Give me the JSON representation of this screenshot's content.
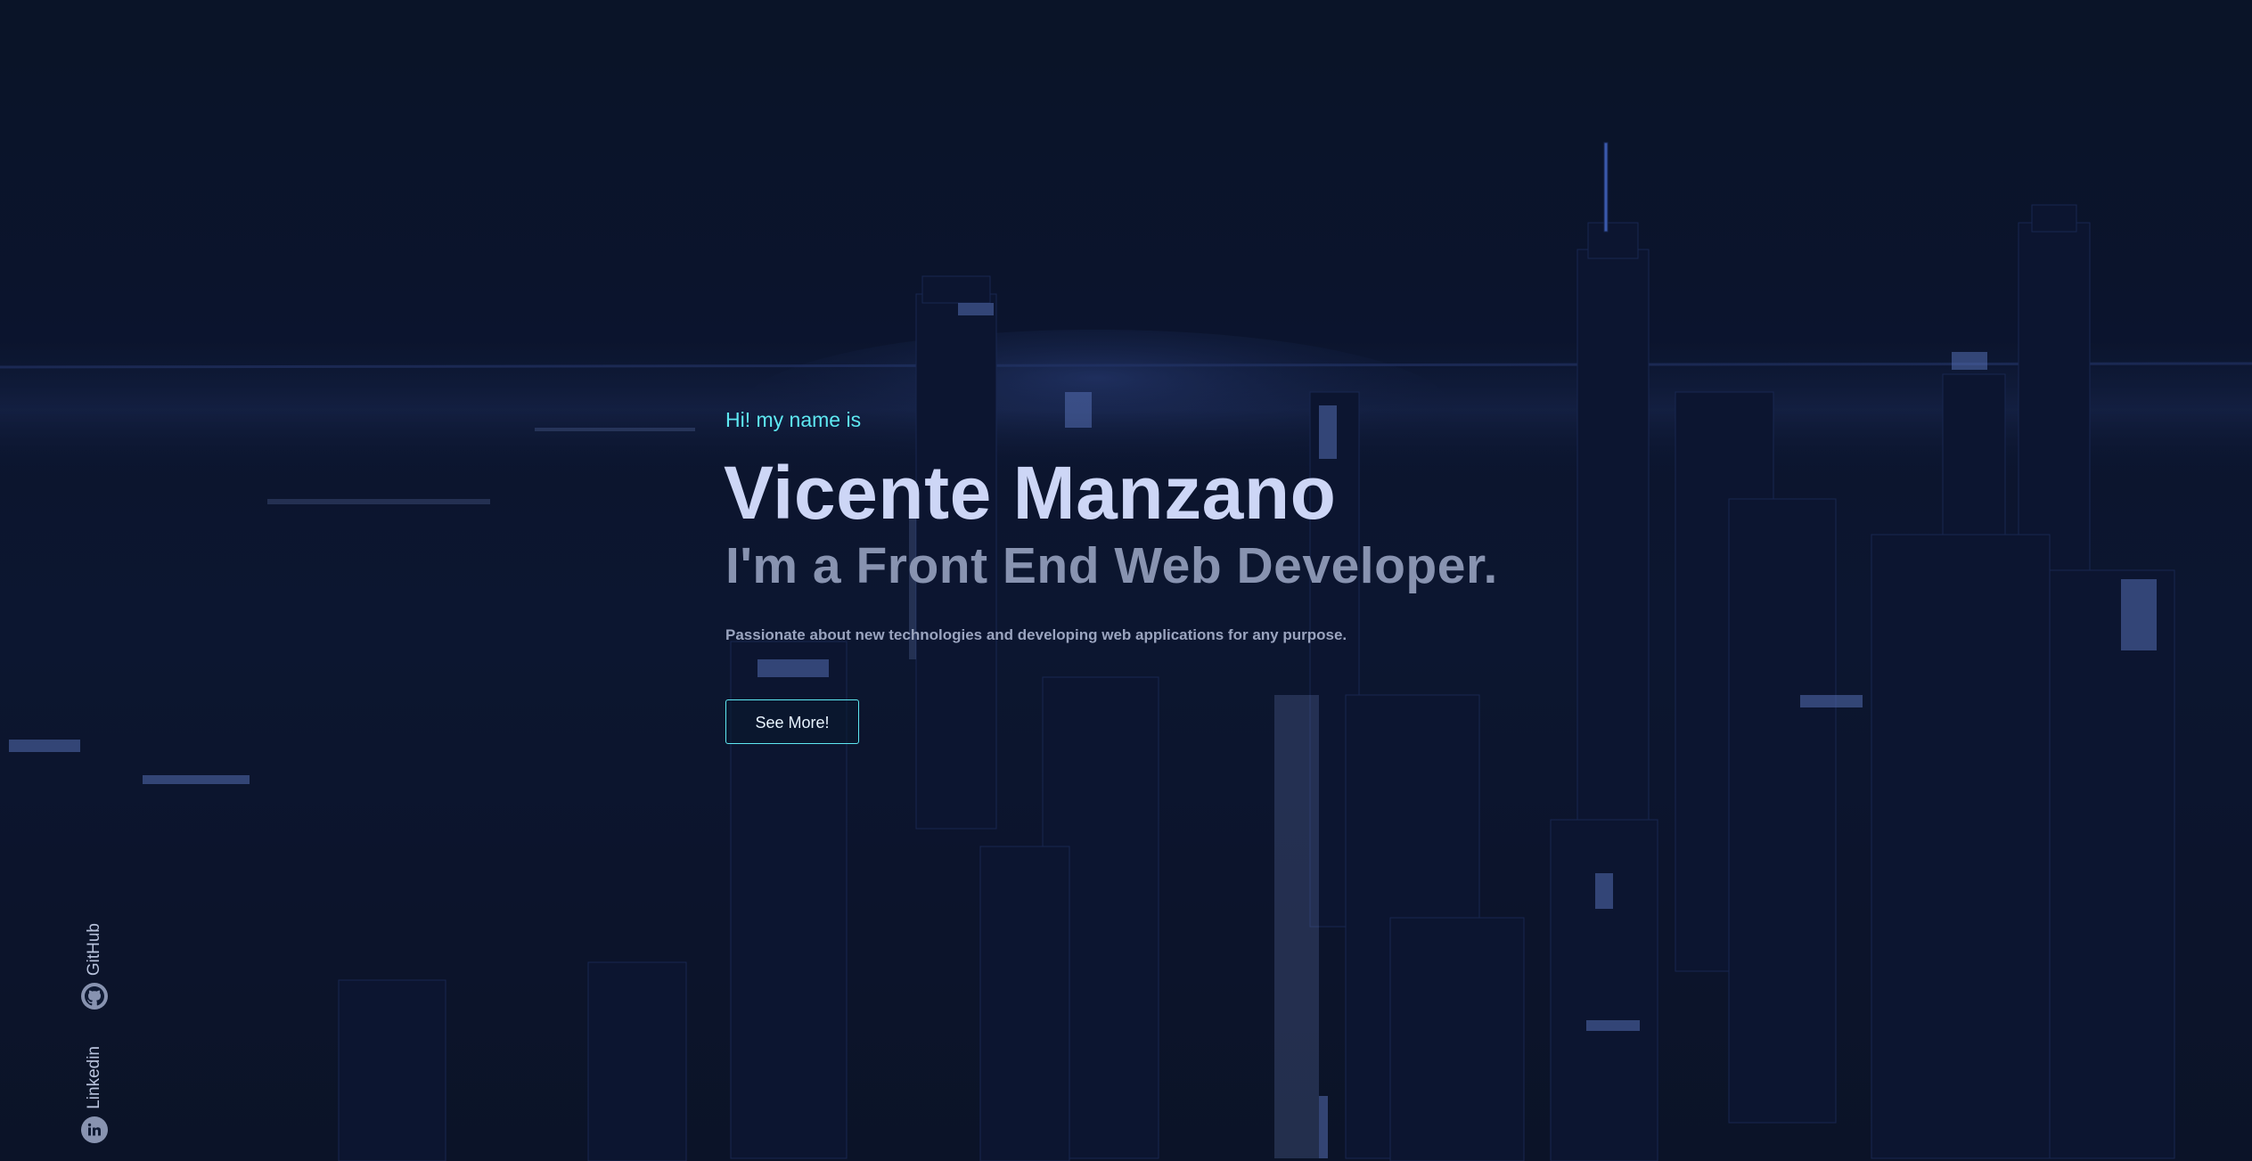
{
  "hero": {
    "greeting": "Hi! my name is",
    "name": "Vicente Manzano",
    "role": "I'm a Front End Web Developer.",
    "tagline": "Passionate about new technologies and developing web applications for any purpose.",
    "cta_label": "See More!"
  },
  "social": {
    "links": [
      {
        "label": "GitHub",
        "icon": "github-icon"
      },
      {
        "label": "Linkedin",
        "icon": "linkedin-icon"
      }
    ]
  },
  "colors": {
    "background": "#0a1326",
    "accent": "#5ee8f2",
    "name": "#cdd6f6",
    "role": "#8893b0",
    "text": "#9aa4bf"
  }
}
